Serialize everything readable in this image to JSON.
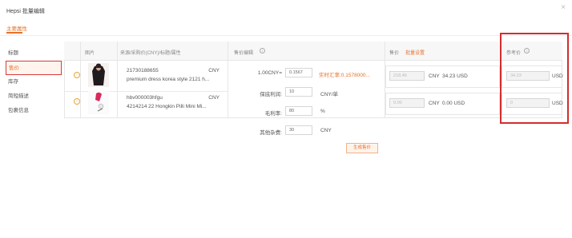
{
  "window": {
    "title": "Hepsi 批量编辑",
    "close_icon": "close-icon"
  },
  "tab": {
    "label": "主要属性"
  },
  "sidebar": {
    "items": [
      {
        "label": "标题",
        "active": false
      },
      {
        "label": "售价",
        "active": true
      },
      {
        "label": "库存",
        "active": false
      },
      {
        "label": "简短描述",
        "active": false
      },
      {
        "label": "包裹信息",
        "active": false
      }
    ]
  },
  "table": {
    "headers": {
      "image": "图片",
      "source": "来源/采购价(CNY)/标题/属性",
      "editor": "售价编辑",
      "price": "售价",
      "bulk_set": "批量设置",
      "ref_price": "参考价"
    },
    "rows": [
      {
        "sku": "21730188655",
        "currency": "CNY",
        "title": "premium dress korea style 2121 h...",
        "price_value": "218.46",
        "price_unit": "CNY",
        "converted": "34.23 USD",
        "ref_value": "34.23",
        "ref_unit": "USD"
      },
      {
        "sku": "hbv000003hfgu",
        "currency": "CNY",
        "title": "4214214 22 Hongkin Pilli Mini Mi...",
        "price_value": "0.00",
        "price_unit": "CNY",
        "converted": "0.00 USD",
        "ref_value": "0",
        "ref_unit": "USD"
      }
    ]
  },
  "calc": {
    "rate_label": "1.00CNY=",
    "rate_value": "0.1567",
    "rate_live": "实时汇率:0.1578000...",
    "shipping_label": "保底利润:",
    "shipping_value": "10",
    "shipping_unit": "CNY/单",
    "margin_label": "毛利率:",
    "margin_value": "80",
    "margin_unit": "%",
    "other_label": "其他杂费:",
    "other_value": "30",
    "other_unit": "CNY",
    "generate_label": "生成售价"
  },
  "colors": {
    "accent": "#e8702a",
    "highlight": "#d42d2d"
  }
}
